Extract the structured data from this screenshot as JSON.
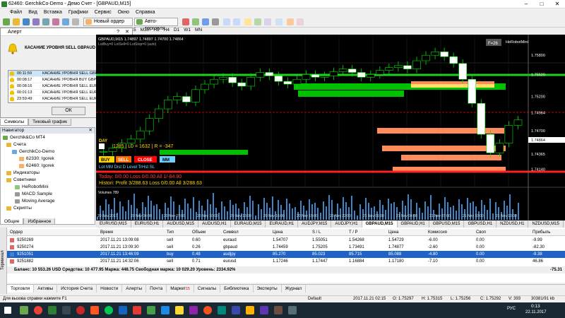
{
  "window": {
    "title": "62460: GerchikCo-Demo - Демо Счет - [GBPAUD,M15]"
  },
  "menu": [
    "Файл",
    "Вид",
    "Вставка",
    "Графики",
    "Сервис",
    "Окно",
    "Справка"
  ],
  "toolbar": {
    "new_order": "Новый ордер",
    "autotrading": "Авто-торговля"
  },
  "timeframes": [
    "M30",
    "H1",
    "H4",
    "D1",
    "W1",
    "MN"
  ],
  "timeframe_m15": "M15",
  "alert": {
    "title": "Алерт",
    "message": "КАСАНИЕ УРОВНЯ SELL GBPAUD",
    "rows": [
      {
        "time": "00:11:59",
        "text": "КАСАНИЕ УРОВНЯ SELL GBPAUD"
      },
      {
        "time": "00:08:17",
        "text": "КАСАНИЕ УРОВНЯ BUY GBPCHF"
      },
      {
        "time": "00:08:16",
        "text": "КАСАНИЕ УРОВНЯ SELL EURAUD"
      },
      {
        "time": "00:01:13",
        "text": "КАСАНИЕ УРОВНЯ SELL EURGBP"
      },
      {
        "time": "23:59:49",
        "text": "КАСАНИЕ УРОВНЯ SELL EURUSD"
      }
    ],
    "ok": "ОК"
  },
  "left_tabs": [
    "Символы",
    "Тиковый график"
  ],
  "navigator": {
    "title": "Навигатор",
    "items": [
      "Gerchik&Co MT4",
      "Счета",
      "GerchikCo-Demo",
      "62330: Igorek",
      "62460: Igorek",
      "Индикаторы",
      "Советники",
      "HeRobotMini",
      "MACD Sample",
      "Moving Average",
      "Скрипты"
    ],
    "tabs": [
      "Общие",
      "Избранное"
    ]
  },
  "chart": {
    "label_tl": "GBPAUD,M15  1.74897 1.74897 1.74700 1.74864",
    "label_tl2": "LotBuy=0  LotSell=0  LotStop=0 (auto)",
    "badge": "F=26",
    "robot": "HeRobotMini",
    "day": "DAY",
    "info_line": "1285 | L0 = 1632 | R = -347",
    "btn_buy": "BUY",
    "btn_sell": "SELL",
    "btn_close": "CLOSE",
    "btn_mm": "MM",
    "params": "Lot  MM  Dist  D    Level  TrHst  SL",
    "today": "Today: 0/0.00   Loss 0/0.00   All 1/-84.90",
    "history": "Histori: Profit 3/288.63  Loss 0/0.00  All 3/288.63",
    "volumes": "Volumes 789",
    "price_labels": [
      "1.75800",
      "1.75520",
      "1.75200",
      "1.74964",
      "1.74700",
      "1.74365",
      "1.74140"
    ],
    "time_labels": [
      "20 Nov 2017",
      "20 Nov 04:00",
      "20 Nov 07:00",
      "20 Nov 10:00",
      "20 Nov 13:00",
      "20 Nov 16:00",
      "20 Nov 19:00",
      "20 Nov 22:00",
      "21 Nov 01:00",
      "21 Nov 04:00",
      "21 Nov 07:00",
      "21 Nov 10:00",
      "21 Nov 13:00"
    ],
    "current_price": "1.74864"
  },
  "chart_tabs": [
    "EURUSD,M15",
    "EURUSD,H1",
    "AUDUSD,M15",
    "AUDUSD,H1",
    "EURAUD,M15",
    "EURAUD,H1",
    "AUDJPY,M15",
    "AUDJPY,H1",
    "GBPAUD,M15",
    "GBPAUD,H1",
    "GBPUSD,M15",
    "GBPUSD,H1",
    "NZDUSD,H1",
    "NZDUSD,M15"
  ],
  "chart_tab_active": "GBPAUD,M15",
  "terminal": {
    "headers": [
      "Ордер",
      "Время",
      "Тип",
      "Объем",
      "Символ",
      "Цена",
      "S / L",
      "T / P",
      "Цена",
      "Комиссия",
      "Своп",
      "Прибыль"
    ],
    "rows": [
      [
        "9250269",
        "2017.11.21 13:09:08",
        "sell",
        "0.60",
        "euraud",
        "1.54707",
        "1.55051",
        "1.54268",
        "1.54729",
        "-6.00",
        "-9.99"
      ],
      [
        "9250274",
        "2017.11.21 13:09:30",
        "sell",
        "0.26",
        "gbpaud",
        "1.74459",
        "1.75205",
        "1.73491",
        "1.74877",
        "-2.60",
        "-82.30"
      ],
      [
        "9251051",
        "2017.11.21 13:46:09",
        "buy",
        "0.48",
        "audjpy",
        "85.270",
        "85.023",
        "85.715",
        "85.088",
        "-4.80",
        "-9.38"
      ],
      [
        "9251882",
        "2017.11.21 14:32:06",
        "sell",
        "0.71",
        "eurusd",
        "1.17246",
        "1.17447",
        "1.16884",
        "1.17180",
        "-7.10",
        "46.86"
      ]
    ],
    "swaps": [
      "0.00",
      "0.00",
      "0.00",
      "0.00"
    ],
    "balance": "Баланс: 10 553.26 USD  Средства: 10 477.95  Маржа: 448.75  Свободная маржа: 10 029.20  Уровень: 2334.92%",
    "total": "-75.31",
    "side_label": "Терминал",
    "tabs": [
      "Торговля",
      "Активы",
      "История Счета",
      "Новости",
      "Алерты",
      "Почта",
      "Маркет",
      "Сигналы",
      "Библиотека",
      "Эксперты",
      "Журнал"
    ],
    "market_badge": "15"
  },
  "status": {
    "help": "Для вызова справки нажмите F1",
    "profile": "Default",
    "time": "2017.11.21 02:15",
    "o": "O: 1.75297",
    "h": "H: 1.75315",
    "l": "L: 1.75256",
    "c": "C: 1.75292",
    "v": "V: 393",
    "traffic": "30381/91 kb"
  },
  "taskbar": {
    "clock": "0:13",
    "date": "22.11.2017",
    "lang": "РУС"
  },
  "chart_data": {
    "type": "candlestick",
    "title": "GBPAUD,M15",
    "y_ticks": [
      "1.75800",
      "1.75520",
      "1.75200",
      "1.74964",
      "1.74700",
      "1.74365",
      "1.74140"
    ],
    "x_ticks": [
      "20 Nov 2017",
      "20 Nov 04:00",
      "20 Nov 07:00",
      "20 Nov 10:00",
      "20 Nov 13:00",
      "20 Nov 16:00",
      "20 Nov 19:00",
      "20 Nov 22:00",
      "21 Nov 01:00",
      "21 Nov 04:00",
      "21 Nov 07:00",
      "21 Nov 10:00",
      "21 Nov 13:00"
    ],
    "ylim": [
      1.739,
      1.761
    ],
    "close": [
      1.744,
      1.7445,
      1.7452,
      1.7458,
      1.747,
      1.7488,
      1.7502,
      1.7515,
      1.752,
      1.7512,
      1.753,
      1.7538,
      1.7545,
      1.7548,
      1.754,
      1.7535,
      1.7548,
      1.7555,
      1.755,
      1.7542,
      1.7538,
      1.7545,
      1.7552,
      1.7548,
      1.755,
      1.7556,
      1.756,
      1.7555,
      1.7548,
      1.7552,
      1.7558,
      1.7562,
      1.7565,
      1.756,
      1.7572,
      1.758,
      1.7585,
      1.7578,
      1.7568,
      1.7545,
      1.751,
      1.7465,
      1.7438,
      1.7452,
      1.7478,
      1.7486
    ]
  }
}
